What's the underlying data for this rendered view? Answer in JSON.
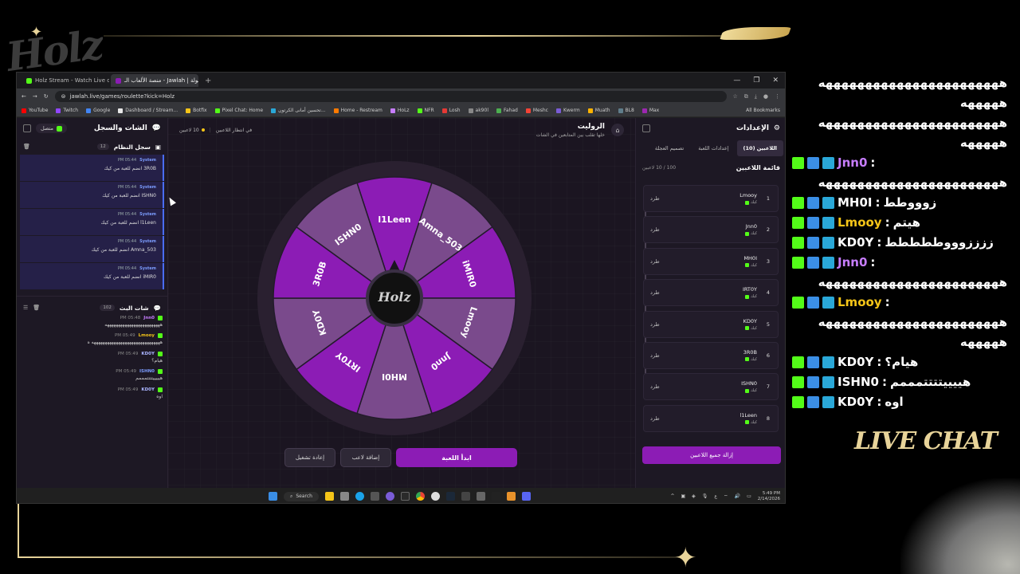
{
  "browser": {
    "tabs": [
      {
        "label": "Holz Stream - Watch Live on Ki",
        "active": false
      },
      {
        "label": "منصة الألعاب الـ - Jawlah | جولة",
        "active": true
      }
    ],
    "url": "jawlah.live/games/roulette?kick=Holz",
    "bookmarks": [
      "YouTube",
      "Twitch",
      "Google",
      "Dashboard / Stream...",
      "Botfix",
      "Pixel Chat: Home",
      "تحسين أمانى الكرتون...",
      "Home - Restream",
      "HoLz",
      "NFR",
      "Losh",
      "ak90l",
      "Fahad",
      "Meshc",
      "Kwerm",
      "Muath",
      "BL8",
      "Max"
    ],
    "all_bookmarks": "All Bookmarks"
  },
  "left_panel": {
    "title": "الشات والسجل",
    "status": "متصل",
    "system_section": {
      "title": "سجل النظام",
      "count": "12"
    },
    "system_messages": [
      {
        "who": "System",
        "time": "PM 05:44",
        "text": "3R0B انضم للعبة من كيك"
      },
      {
        "who": "System",
        "time": "PM 05:44",
        "text": "ISHN0 انضم للعبة من كيك"
      },
      {
        "who": "System",
        "time": "PM 05:44",
        "text": "l1Leen انضم للعبة من كيك"
      },
      {
        "who": "System",
        "time": "PM 05:44",
        "text": "Amna_503 انضم للعبة من كيك"
      },
      {
        "who": "System",
        "time": "PM 05:44",
        "text": "iMIR0 انضم للعبة من كيك"
      }
    ],
    "chat_section": {
      "title": "شات البث",
      "count": "102"
    },
    "chat_messages": [
      {
        "who": "Jnn0",
        "color": "#c77dff",
        "time": "PM 05:48",
        "text": "هههههههههههههههههههههههههه"
      },
      {
        "who": "Lmooy",
        "color": "#f5c518",
        "time": "PM 05:49",
        "text": "هههههههههههههههههههههههههههههههه ه"
      },
      {
        "who": "KD0Y",
        "color": "#aab4ff",
        "time": "PM 05:49",
        "text": "هيام؟"
      },
      {
        "who": "ISHN0",
        "color": "#7c9dff",
        "time": "PM 05:49",
        "text": "هيييييتتتتمممم"
      },
      {
        "who": "KD0Y",
        "color": "#aab4ff",
        "time": "PM 05:49",
        "text": "اوه"
      }
    ]
  },
  "center": {
    "title": "الروليت",
    "subtitle": "خلها تقلب بين المتابعين في الشات",
    "player_count": "10 لاعبين",
    "waiting": "في انتظار اللاعبين",
    "wheel_segments": [
      "l1Leen",
      "Amna_503",
      "iMIR0",
      "Lmooy",
      "Jnn0",
      "MH0I",
      "IRT0Y",
      "KD0Y",
      "3R0B",
      "ISHN0"
    ],
    "wheel_colors": [
      "#8c1cb5",
      "#7a4a8c"
    ],
    "hub_logo": "Holz",
    "buttons": {
      "start": "ابدأ اللعبة",
      "add": "إضافة لاعب",
      "restart": "إعادة تشغيل"
    }
  },
  "right_panel": {
    "title": "الإعدادات",
    "tabs": [
      "اللاعبين (10)",
      "إعدادات اللعبة",
      "تصميم العجلة"
    ],
    "list_title": "قائمة اللاعبين",
    "capacity": "100 / 10 لاعبين",
    "players": [
      {
        "num": "1",
        "name": "Lmooy",
        "src": "كيك",
        "kick": "طرد"
      },
      {
        "num": "2",
        "name": "Jnn0",
        "src": "كيك",
        "kick": "طرد"
      },
      {
        "num": "3",
        "name": "MH0I",
        "src": "كيك",
        "kick": "طرد"
      },
      {
        "num": "4",
        "name": "IRT0Y",
        "src": "كيك",
        "kick": "طرد"
      },
      {
        "num": "5",
        "name": "KD0Y",
        "src": "كيك",
        "kick": "طرد"
      },
      {
        "num": "6",
        "name": "3R0B",
        "src": "كيك",
        "kick": "طرد"
      },
      {
        "num": "7",
        "name": "ISHN0",
        "src": "كيك",
        "kick": "طرد"
      },
      {
        "num": "8",
        "name": "l1Leen",
        "src": "كيك",
        "kick": "طرد"
      }
    ],
    "clear_all": "إزالة جميع اللاعبين"
  },
  "taskbar": {
    "search": "Search",
    "time": "5:49 PM",
    "date": "2/14/2026",
    "lang": "ع"
  },
  "overlay": {
    "live_chat_title": "LIVE CHAT",
    "lines": [
      {
        "type": "text",
        "text": "هههههههههههههههههههههههه"
      },
      {
        "type": "text",
        "text": "هههههه"
      },
      {
        "type": "text",
        "text": "هههههههههههههههههههههههه"
      },
      {
        "type": "text",
        "text": "هههههه"
      },
      {
        "type": "user",
        "user": "Jnn0",
        "color": "#c77dff",
        "msg": ""
      },
      {
        "type": "text",
        "text": "هههههههههههههههههههههههه"
      },
      {
        "type": "user",
        "user": "MH0I",
        "color": "#ffffff",
        "msg": "زوووطط"
      },
      {
        "type": "user",
        "user": "Lmooy",
        "color": "#f5c518",
        "msg": "هيتم"
      },
      {
        "type": "user",
        "user": "KD0Y",
        "color": "#ffffff",
        "msg": "ززززوووططططط"
      },
      {
        "type": "user",
        "user": "Jnn0",
        "color": "#c77dff",
        "msg": ""
      },
      {
        "type": "text",
        "text": "هههههههههههههههههههههههه"
      },
      {
        "type": "user",
        "user": "Lmooy",
        "color": "#f5c518",
        "msg": ""
      },
      {
        "type": "text",
        "text": "هههههههههههههههههههههههه"
      },
      {
        "type": "text",
        "text": "هههههه"
      },
      {
        "type": "user",
        "user": "KD0Y",
        "color": "#ffffff",
        "msg": "هيام؟"
      },
      {
        "type": "user",
        "user": "ISHN0",
        "color": "#ffffff",
        "msg": "هييييتتتتمممم"
      },
      {
        "type": "user",
        "user": "KD0Y",
        "color": "#ffffff",
        "msg": "اوه"
      }
    ]
  }
}
